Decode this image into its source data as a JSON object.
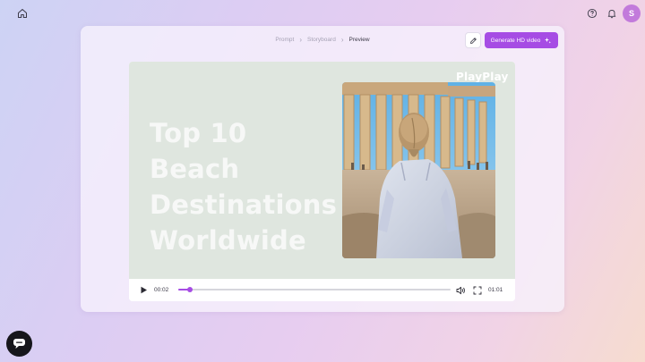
{
  "topbar": {
    "home_icon": "home-icon",
    "help_icon": "help-circle-icon",
    "bell_icon": "bell-icon",
    "avatar_initial": "S"
  },
  "breadcrumb": {
    "items": [
      "Prompt",
      "Storyboard",
      "Preview"
    ],
    "current_index": 2
  },
  "actions": {
    "edit_icon": "pencil-icon",
    "generate_label": "Generate HD video",
    "generate_icon": "sparkles-icon"
  },
  "video": {
    "headline": "Top 10 Beach\nDestinations\nWorldwide",
    "logo_text": "PlayPlay",
    "photo_description_icon": "acropolis-photo"
  },
  "player": {
    "current_time": "00:02",
    "duration": "01:01",
    "progress_fraction": 0.043,
    "play_icon": "play-icon",
    "volume_icon": "volume-icon",
    "fullscreen_icon": "fullscreen-icon"
  },
  "chat": {
    "icon": "chat-bubble-icon"
  },
  "colors": {
    "accent": "#a64ce4",
    "avatar": "#c27adb",
    "video_bg": "#dfe6df"
  }
}
